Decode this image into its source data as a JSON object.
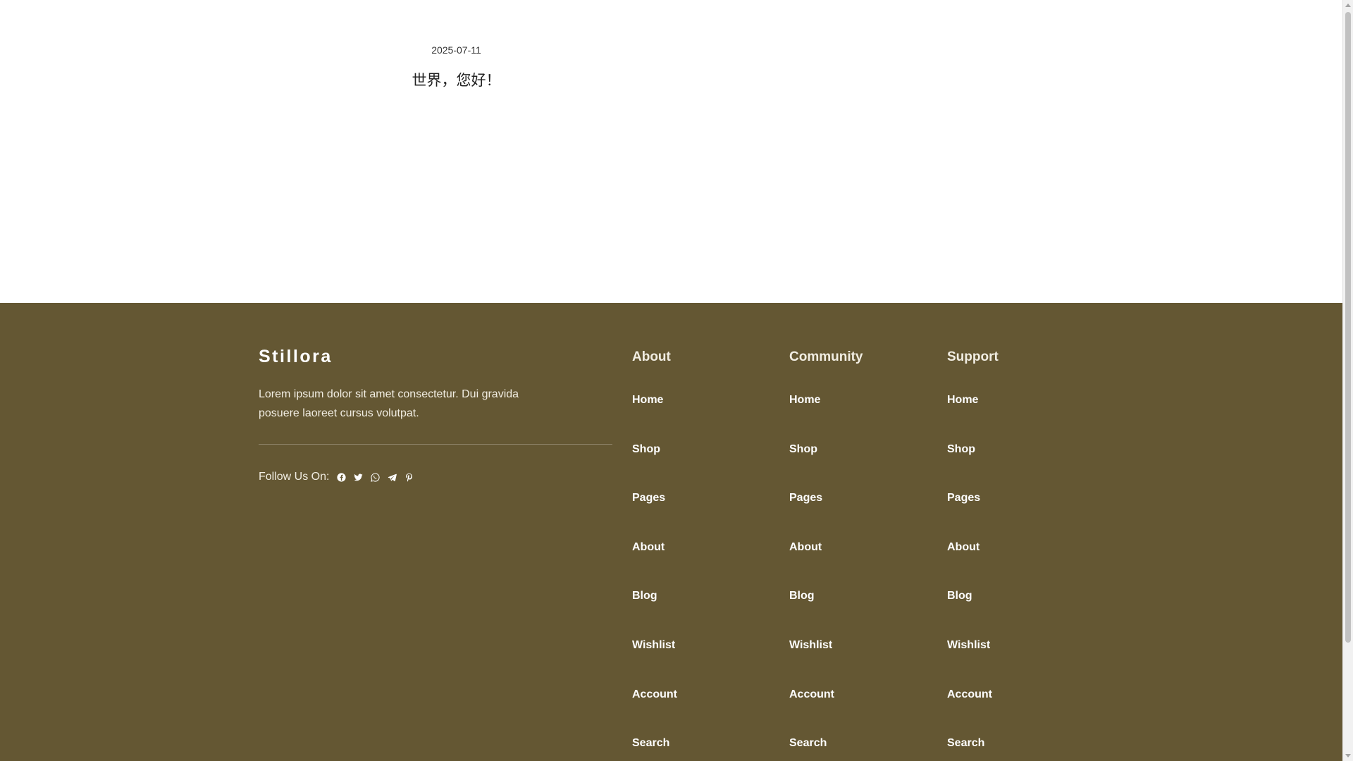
{
  "post": {
    "date": "2025-07-11",
    "title": "世界，您好！"
  },
  "footer": {
    "brand": "Stillora",
    "description": "Lorem ipsum dolor sit amet consectetur. Dui gravida posuere laoreet cursus volutpat.",
    "follow_label": "Follow Us On:",
    "social_icons": [
      "facebook-icon",
      "twitter-icon",
      "whatsapp-icon",
      "telegram-icon",
      "pinterest-icon"
    ],
    "columns": [
      {
        "heading": "About",
        "links": [
          "Home",
          "Shop",
          "Pages",
          "About",
          "Blog",
          "Wishlist",
          "Account",
          "Search"
        ]
      },
      {
        "heading": "Community",
        "links": [
          "Home",
          "Shop",
          "Pages",
          "About",
          "Blog",
          "Wishlist",
          "Account",
          "Search"
        ]
      },
      {
        "heading": "Support",
        "links": [
          "Home",
          "Shop",
          "Pages",
          "About",
          "Blog",
          "Wishlist",
          "Account",
          "Search"
        ]
      }
    ]
  },
  "colors": {
    "footer_background": "#645733",
    "page_background": "#ffffff"
  }
}
